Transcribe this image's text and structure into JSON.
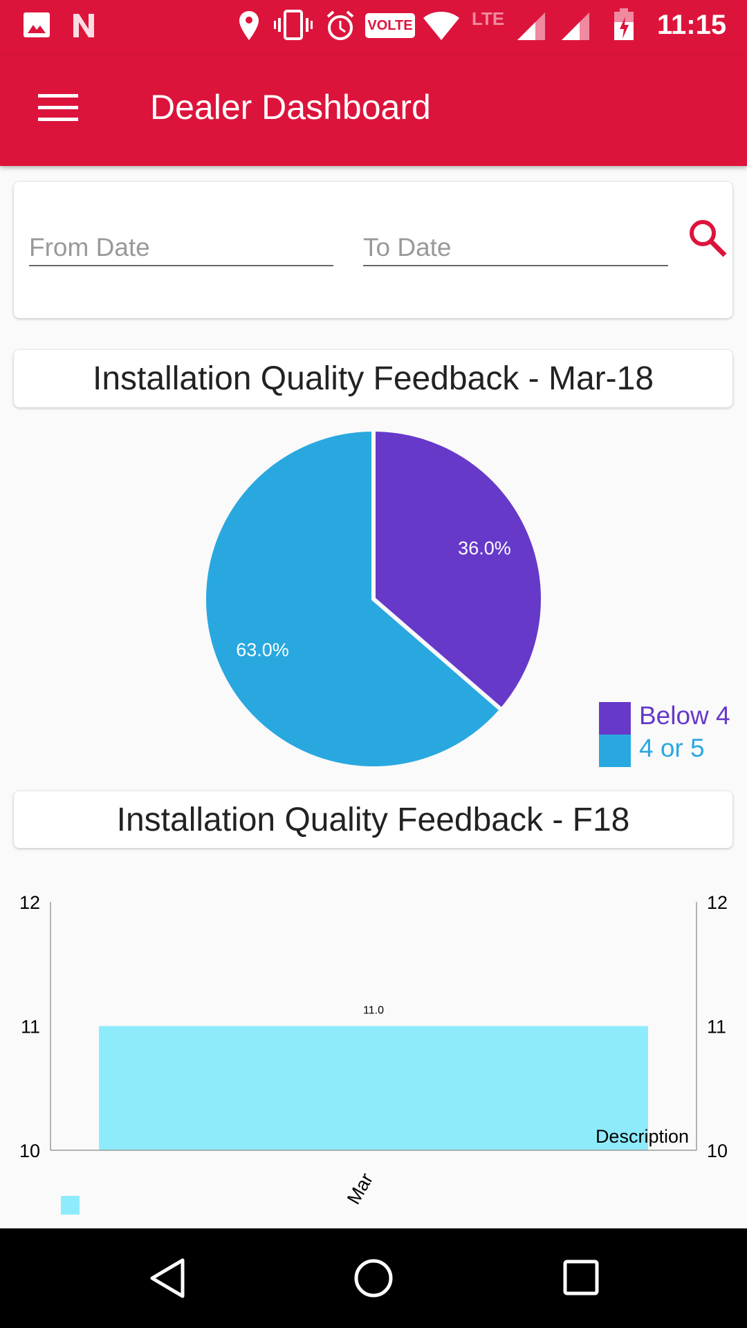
{
  "status_bar": {
    "time": "11:15",
    "icons": [
      "image-icon",
      "n-icon",
      "location-icon",
      "vibrate-icon",
      "alarm-icon",
      "volte-badge",
      "wifi-icon",
      "lte-icon",
      "signal-icon",
      "signal-icon",
      "battery-charging-icon"
    ],
    "volte": "VOLTE",
    "lte": "LTE"
  },
  "app_bar": {
    "title": "Dealer Dashboard",
    "menu_icon": "hamburger-menu-icon"
  },
  "filter": {
    "from_placeholder": "From Date",
    "to_placeholder": "To Date",
    "search_icon": "search-icon"
  },
  "colors": {
    "primary": "#dc143c",
    "below4": "#6639c9",
    "four_or_five": "#29a8e0",
    "bar": "#8eebfc"
  },
  "chart_data": [
    {
      "type": "pie",
      "title": "Installation Quality Feedback - Mar-18",
      "slices": [
        {
          "label": "Below 4",
          "value": 36.0,
          "text": "36.0%",
          "color": "#6639c9"
        },
        {
          "label": "4 or 5",
          "value": 63.0,
          "text": "63.0%",
          "color": "#29a8e0"
        }
      ],
      "legend": "bottom-right"
    },
    {
      "type": "bar",
      "title": "Installation Quality Feedback - F18",
      "categories": [
        "Mar"
      ],
      "values": [
        11.0
      ],
      "value_labels": [
        "11.0"
      ],
      "ylim": [
        10,
        12
      ],
      "yticks": [
        "10",
        "11",
        "12"
      ],
      "description": "Description",
      "grid": false,
      "legend": "bottom-left"
    }
  ]
}
